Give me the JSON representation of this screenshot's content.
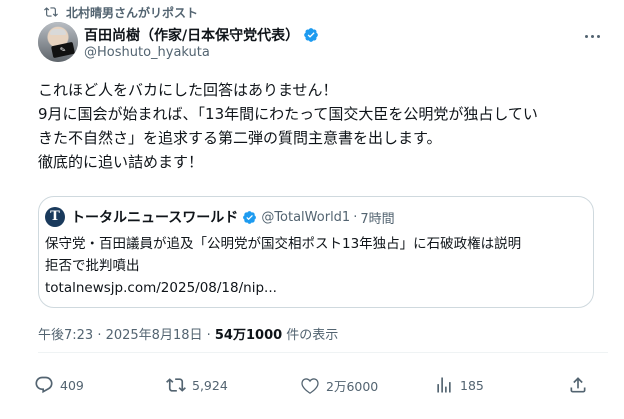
{
  "repost": {
    "text": "北村晴男さんがリポスト"
  },
  "author": {
    "name": "百田尚樹（作家/日本保守党代表）",
    "handle": "@Hoshuto_hyakuta"
  },
  "tweet": {
    "lines": [
      "これほど人をバカにした回答はありません！",
      "9月に国会が始まれば、「13年間にわたって国交大臣を公明党が独占してい",
      "きた不自然さ」を追求する第二弾の質問主意書を出します。",
      "徹底的に追い詰めます！"
    ]
  },
  "quote": {
    "avatar_letter": "T",
    "name": "トータルニュースワールド",
    "handle": "@TotalWorld1",
    "separator": "·",
    "time": "7時間",
    "lines": [
      "保守党・百田議員が追及「公明党が国交相ポスト13年独占」に石破政権は説明",
      "拒否で批判噴出"
    ],
    "link": "totalnewsjp.com/2025/08/18/nip..."
  },
  "meta": {
    "timestamp": "午後7:23 · 2025年8月18日 · ",
    "views": "54万1000",
    "views_suffix": " 件の表示"
  },
  "actions": {
    "replies": "409",
    "reposts": "5,924",
    "likes": "2万6000",
    "bookmarks": "185"
  },
  "colors": {
    "verified": "#1d9bf0",
    "muted": "#536471",
    "text": "#0f1419",
    "border": "#cfd9de"
  },
  "icons": [
    "repost-icon",
    "verified-icon",
    "more-icon",
    "reply-icon",
    "retweet-icon",
    "like-icon",
    "views-icon",
    "share-icon"
  ]
}
